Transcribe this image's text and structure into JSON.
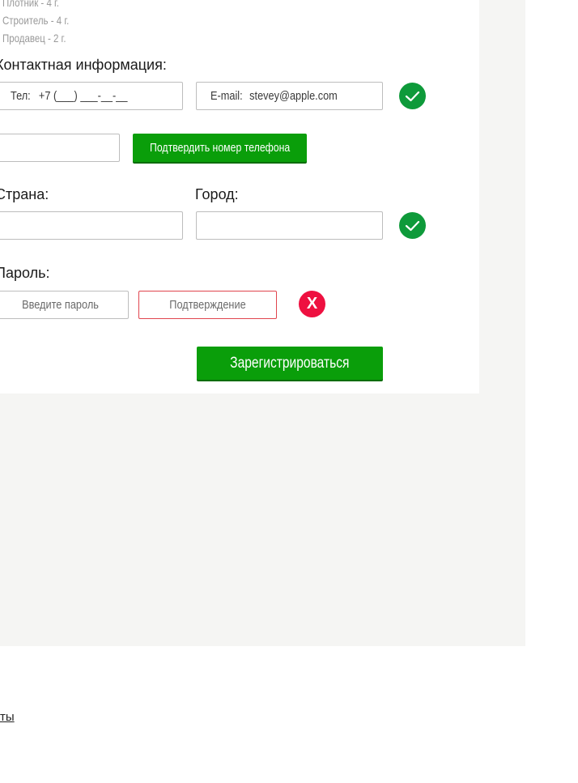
{
  "experience": [
    "Плотник - 4 г.",
    "Строитель - 4 г.",
    "Продавец - 2 г."
  ],
  "contact": {
    "heading": "Контактная информация:",
    "phone_label": "Тел:",
    "phone_mask": "+7 (___) ___-__-__",
    "email_label": "E-mail:",
    "email_value": "stevey@apple.com",
    "code_value": "",
    "verify_button": "Подтвердить номер телефона",
    "status": "valid"
  },
  "location": {
    "country_label": "Страна:",
    "city_label": "Город:",
    "country_value": "",
    "city_value": "",
    "status": "valid"
  },
  "password": {
    "heading": "Пароль:",
    "password_placeholder": "Введите пароль",
    "confirm_placeholder": "Подтверждение",
    "status": "error",
    "error_mark": "X"
  },
  "register_button": "Зарегистрироваться",
  "footer_link": "ты",
  "colors": {
    "accent": "#0a9e0a",
    "success": "#0e9a3a",
    "error": "#ee1040",
    "error_border": "#e0454e"
  }
}
